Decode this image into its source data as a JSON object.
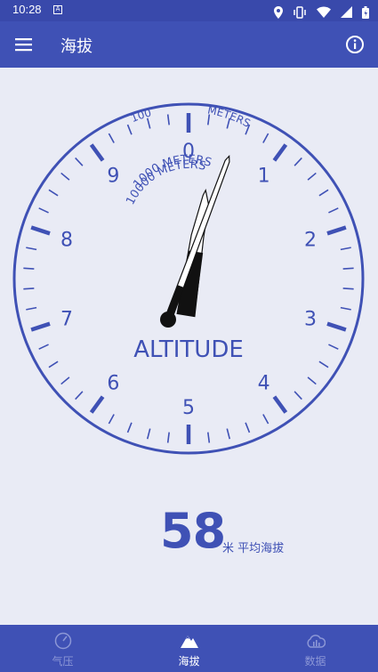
{
  "status_bar": {
    "time": "10:28",
    "left_badge": "A",
    "icons": [
      "location-icon",
      "vibrate-icon",
      "wifi-icon",
      "signal-icon",
      "battery-icon"
    ]
  },
  "app_bar": {
    "title": "海拔",
    "menu_icon": "menu-icon",
    "info_icon": "info-icon"
  },
  "gauge": {
    "numbers": [
      "0",
      "1",
      "2",
      "3",
      "4",
      "5",
      "6",
      "7",
      "8",
      "9"
    ],
    "outer_label_100": "100",
    "outer_label_meters": "METERS",
    "inner_label_1000": "1000 METERS",
    "inner_label_10000": "10000 METERS",
    "center_label": "ALTITUDE",
    "altitude_meters": 58,
    "colors": {
      "accent": "#3f51b5",
      "face": "#e9ebf5",
      "needle": "#111111"
    }
  },
  "readout": {
    "value": "58",
    "unit_label": "米 平均海拔"
  },
  "bottom_nav": {
    "items": [
      {
        "label": "气压",
        "icon": "gauge-icon",
        "active": false
      },
      {
        "label": "海拔",
        "icon": "mountain-icon",
        "active": true
      },
      {
        "label": "数据",
        "icon": "cloud-chart-icon",
        "active": false
      }
    ]
  }
}
